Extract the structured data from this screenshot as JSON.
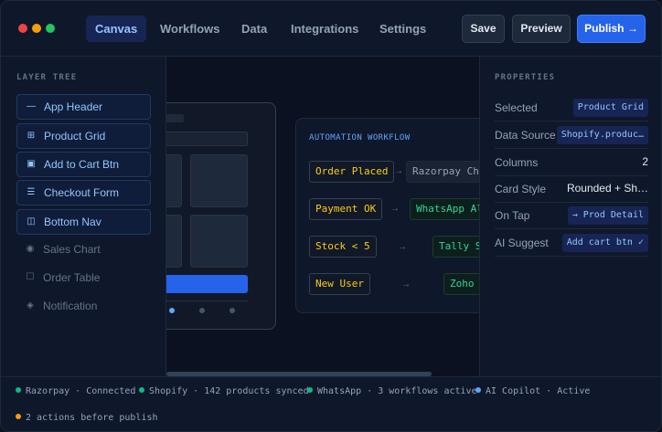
{
  "window": {
    "dots": [
      {
        "name": "close",
        "color": "#ef4444"
      },
      {
        "name": "minimize",
        "color": "#f59e0b"
      },
      {
        "name": "maximize",
        "color": "#22c55e"
      }
    ]
  },
  "nav": {
    "tabs": [
      "Canvas",
      "Workflows",
      "Data",
      "Integrations",
      "Settings"
    ],
    "active_tab": "Canvas"
  },
  "toolbar": {
    "save_label": "Save",
    "preview_label": "Preview",
    "publish_label": "Publish →"
  },
  "layer_tree": {
    "title": "LAYER TREE",
    "items": [
      {
        "label": "App Header",
        "icon": "minus-icon",
        "glyph": "—",
        "highlighted": true
      },
      {
        "label": "Product Grid",
        "icon": "grid-icon",
        "glyph": "⊞",
        "highlighted": true
      },
      {
        "label": "Add to Cart Btn",
        "icon": "button-icon",
        "glyph": "▣",
        "highlighted": true
      },
      {
        "label": "Checkout Form",
        "icon": "list-icon",
        "glyph": "☰",
        "highlighted": true
      },
      {
        "label": "Bottom Nav",
        "icon": "columns-icon",
        "glyph": "◫",
        "highlighted": true
      },
      {
        "label": "Sales Chart",
        "icon": "chart-icon",
        "glyph": "◉",
        "highlighted": false
      },
      {
        "label": "Order Table",
        "icon": "table-icon",
        "glyph": "☐",
        "highlighted": false
      },
      {
        "label": "Notification",
        "icon": "bell-icon",
        "glyph": "◈",
        "highlighted": false
      }
    ]
  },
  "workflow": {
    "title": "AUTOMATION WORKFLOW",
    "rows": [
      {
        "trigger": "Order Placed",
        "action": "Razorpay Cha"
      },
      {
        "trigger": "Payment OK",
        "action": "WhatsApp Ale"
      },
      {
        "trigger": "Stock < 5",
        "action": "Tally Sy"
      },
      {
        "trigger": "New User",
        "action": "Zoho C"
      }
    ],
    "arrow": "→"
  },
  "properties": {
    "title": "PROPERTIES",
    "rows": [
      {
        "key": "Selected",
        "value": "Product Grid",
        "chip": true
      },
      {
        "key": "Data Source",
        "value": "Shopify.produc…",
        "chip": true
      },
      {
        "key": "Columns",
        "value": "2",
        "chip": false
      },
      {
        "key": "Card Style",
        "value": "Rounded + Sh…",
        "chip": false
      },
      {
        "key": "On Tap",
        "value": "→ Prod Detail",
        "chip": true
      },
      {
        "key": "AI Suggest",
        "value": "Add cart btn ✓",
        "chip": true
      }
    ]
  },
  "status": [
    {
      "text": "Razorpay · Connected",
      "color": "#10b981"
    },
    {
      "text": "Shopify · 142 products synced",
      "color": "#10b981"
    },
    {
      "text": "WhatsApp · 3 workflows active",
      "color": "#10b981"
    },
    {
      "text": "AI Copilot · Active",
      "color": "#60a5fa"
    },
    {
      "text": "2 actions before publish",
      "color": "#f59e0b"
    }
  ]
}
